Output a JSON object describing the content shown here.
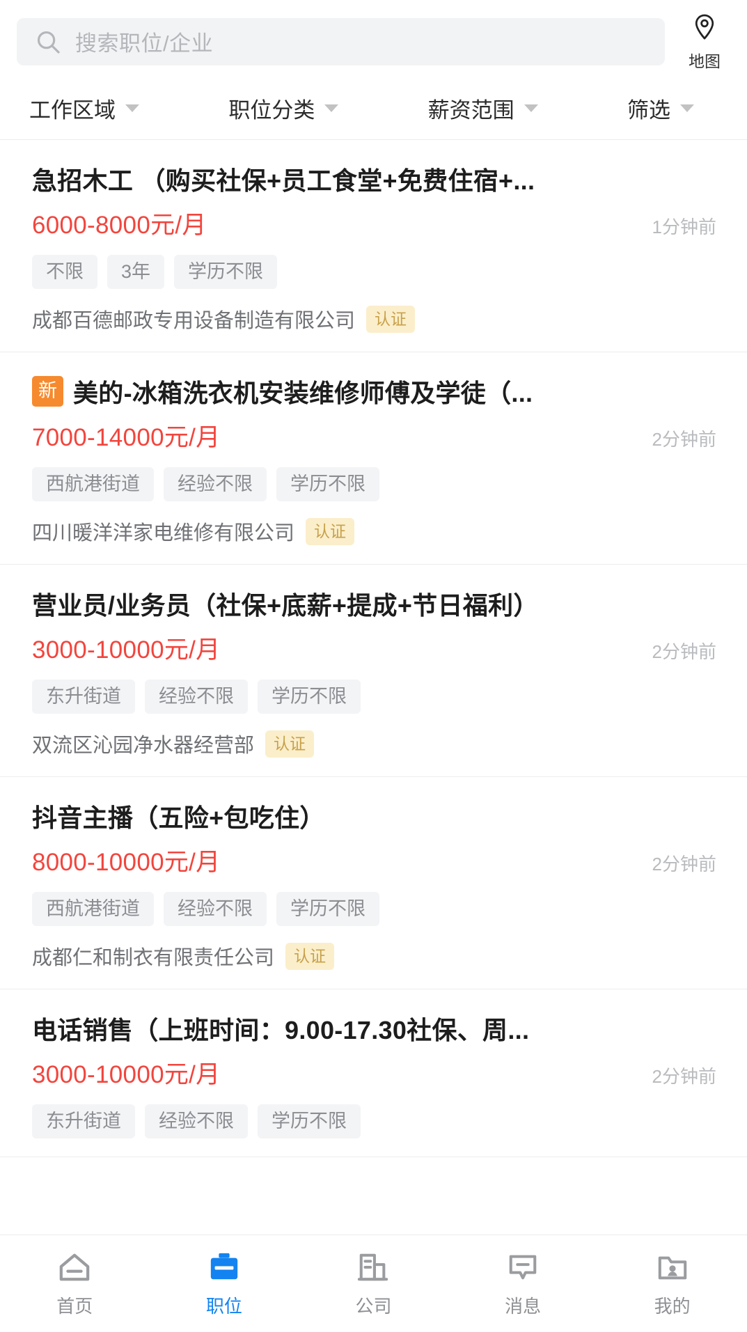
{
  "search": {
    "placeholder": "搜索职位/企业",
    "value": "",
    "icon": "search-icon",
    "map_button": {
      "label": "地图",
      "icon": "map-pin-icon"
    }
  },
  "filters": [
    {
      "label": "工作区域",
      "icon": "chevron-down-icon"
    },
    {
      "label": "职位分类",
      "icon": "chevron-down-icon"
    },
    {
      "label": "薪资范围",
      "icon": "chevron-down-icon"
    },
    {
      "label": "筛选",
      "icon": "chevron-down-icon"
    }
  ],
  "jobs": [
    {
      "badge": "",
      "title": "急招木工 （购买社保+员工食堂+免费住宿+...",
      "salary": "6000-8000元/月",
      "posted": "1分钟前",
      "tags": [
        "不限",
        "3年",
        "学历不限"
      ],
      "company": "成都百德邮政专用设备制造有限公司",
      "cert": "认证"
    },
    {
      "badge": "新",
      "title": "美的-冰箱洗衣机安装维修师傅及学徒（...",
      "salary": "7000-14000元/月",
      "posted": "2分钟前",
      "tags": [
        "西航港街道",
        "经验不限",
        "学历不限"
      ],
      "company": "四川暖洋洋家电维修有限公司",
      "cert": "认证"
    },
    {
      "badge": "",
      "title": "营业员/业务员（社保+底薪+提成+节日福利）",
      "salary": "3000-10000元/月",
      "posted": "2分钟前",
      "tags": [
        "东升街道",
        "经验不限",
        "学历不限"
      ],
      "company": "双流区沁园净水器经营部",
      "cert": "认证"
    },
    {
      "badge": "",
      "title": "抖音主播（五险+包吃住）",
      "salary": "8000-10000元/月",
      "posted": "2分钟前",
      "tags": [
        "西航港街道",
        "经验不限",
        "学历不限"
      ],
      "company": "成都仁和制衣有限责任公司",
      "cert": "认证"
    },
    {
      "badge": "",
      "title": "电话销售（上班时间：9.00-17.30社保、周...",
      "salary": "3000-10000元/月",
      "posted": "2分钟前",
      "tags": [
        "东升街道",
        "经验不限",
        "学历不限"
      ],
      "company": "",
      "cert": ""
    }
  ],
  "bottom_nav": {
    "active_index": 1,
    "items": [
      {
        "label": "首页",
        "icon": "home-icon"
      },
      {
        "label": "职位",
        "icon": "briefcase-icon"
      },
      {
        "label": "公司",
        "icon": "building-icon"
      },
      {
        "label": "消息",
        "icon": "chat-bubble-icon"
      },
      {
        "label": "我的",
        "icon": "profile-card-icon"
      }
    ]
  },
  "colors": {
    "accent": "#1283f0",
    "salary": "#f2453d",
    "new_badge": "#f68a2e",
    "cert_bg": "#fbeecb",
    "cert_text": "#c7a14a"
  }
}
